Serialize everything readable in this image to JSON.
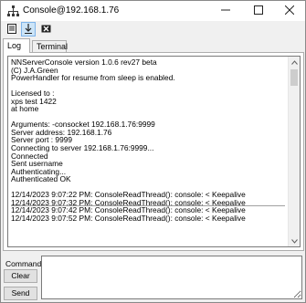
{
  "window": {
    "title": "Console@192.168.1.76"
  },
  "titlebar_buttons": [
    "minimize-icon",
    "maximize-icon",
    "close-icon"
  ],
  "toolbar": {
    "items": [
      {
        "icon": "document-icon",
        "active": false
      },
      {
        "icon": "download-arrow-icon",
        "active": true
      },
      {
        "icon": "clear-x-icon",
        "active": false
      }
    ]
  },
  "tabs": [
    {
      "label": "Log",
      "selected": true
    },
    {
      "label": "Terminal",
      "selected": false
    }
  ],
  "log": {
    "lines": [
      "NNServerConsole version 1.0.6 rev27 beta",
      "(C) J.A.Green",
      "PowerHandler for resume from sleep is enabled.",
      "",
      "Licensed to :",
      "xps test 1422",
      "at home",
      "",
      "Arguments: -consocket 192.168.1.76:9999",
      "Server address: 192.168.1.76",
      "Server port : 9999",
      "Connecting to server 192.168.1.76:9999...",
      "Connected",
      "Sent username",
      "Authenticating...",
      "Authenticated OK",
      "",
      "12/14/2023 9:07:22 PM: ConsoleReadThread(): console: < Keepalive",
      "12/14/2023 9:07:32 PM: ConsoleReadThread(): console: < Keepalive",
      "12/14/2023 9:07:42 PM: ConsoleReadThread(): console: < Keepalive",
      "12/14/2023 9:07:52 PM: ConsoleReadThread(): console: < Keepalive"
    ]
  },
  "command": {
    "label": "Command:",
    "value": "",
    "clear_label": "Clear",
    "send_label": "Send"
  },
  "colors": {
    "selected_tool_bg": "#cce4f7",
    "window_bg": "#f0f0f0"
  }
}
